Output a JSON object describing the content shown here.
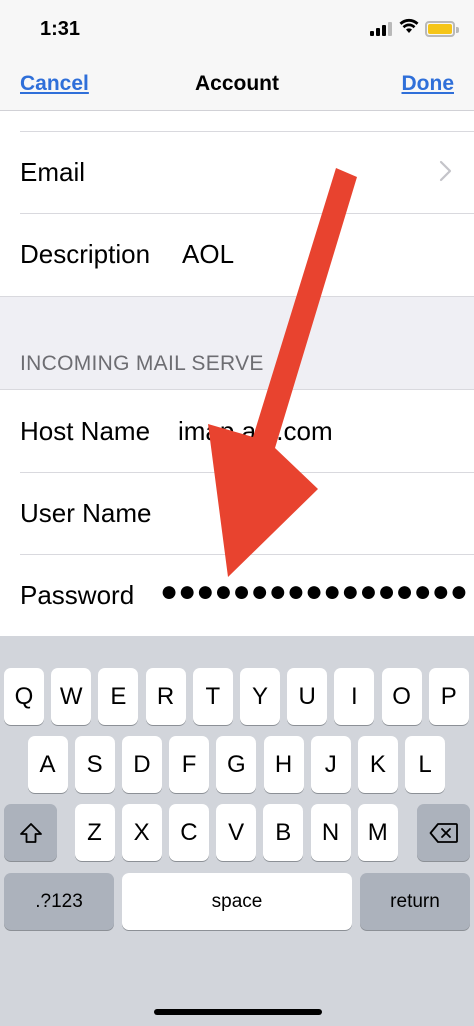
{
  "status_bar": {
    "time": "1:31"
  },
  "nav": {
    "cancel": "Cancel",
    "title": "Account",
    "done": "Done"
  },
  "account": {
    "email_label": "Email",
    "description_label": "Description",
    "description_value": "AOL"
  },
  "incoming": {
    "header": "INCOMING MAIL SERVE",
    "host_label": "Host Name",
    "host_value": "imap.aol.com",
    "user_label": "User Name",
    "user_value": "",
    "password_label": "Password",
    "password_value": "●●●●●●●●●●●●●●●●●"
  },
  "keyboard": {
    "row1": [
      "Q",
      "W",
      "E",
      "R",
      "T",
      "Y",
      "U",
      "I",
      "O",
      "P"
    ],
    "row2": [
      "A",
      "S",
      "D",
      "F",
      "G",
      "H",
      "J",
      "K",
      "L"
    ],
    "row3": [
      "Z",
      "X",
      "C",
      "V",
      "B",
      "N",
      "M"
    ],
    "numbers_label": ".?123",
    "space_label": "space",
    "return_label": "return"
  },
  "colors": {
    "link": "#2f6fd9",
    "arrow": "#e8432f",
    "group_bg": "#efeff4"
  }
}
